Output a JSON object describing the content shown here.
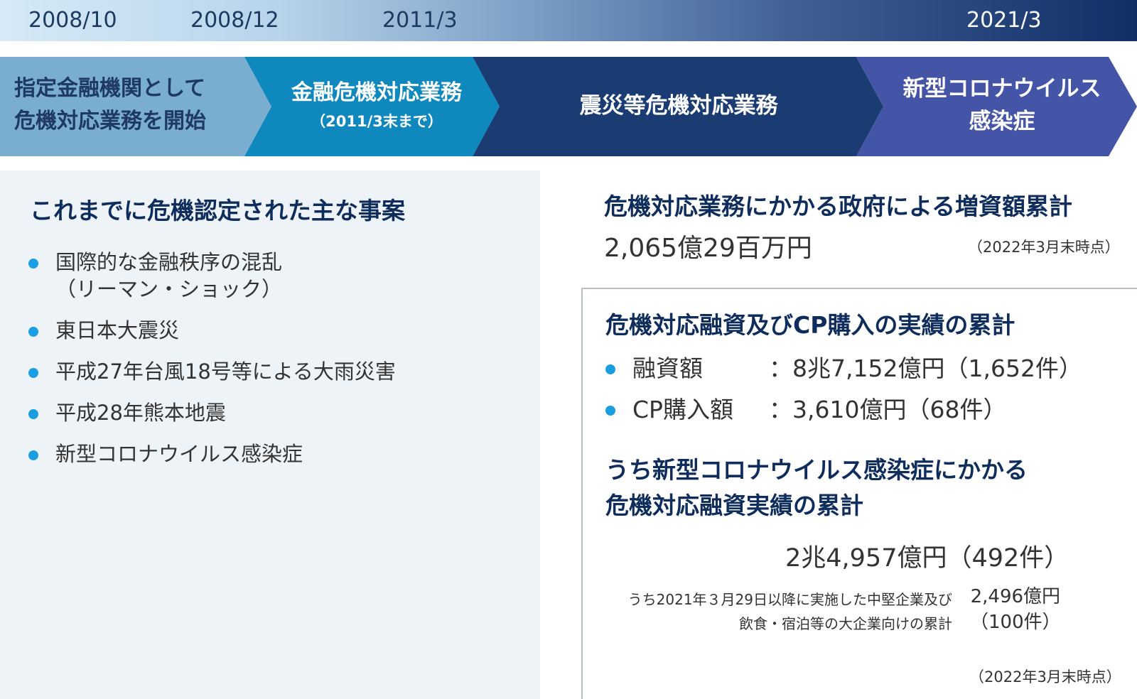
{
  "timeline": {
    "dates": [
      "2008/10",
      "2008/12",
      "2011/3",
      "2021/3"
    ]
  },
  "phases": [
    {
      "line1": "指定金融機関として",
      "line2": "危機対応業務を開始",
      "color": "#7aaed1"
    },
    {
      "line1": "金融危機対応業務",
      "sub": "（2011/3末まで）",
      "color": "#0e88bd"
    },
    {
      "line1": "震災等危機対応業務",
      "color": "#1b3c72"
    },
    {
      "line1": "新型コロナウイルス",
      "line2": "感染症",
      "color": "#4455a8"
    }
  ],
  "left": {
    "title": "これまでに危機認定された主な事案",
    "items": [
      {
        "line1": "国際的な金融秩序の混乱",
        "line2": "（リーマン・ショック）"
      },
      {
        "line1": "東日本大震災"
      },
      {
        "line1": "平成27年台風18号等による大雨災害"
      },
      {
        "line1": "平成28年熊本地震"
      },
      {
        "line1": "新型コロナウイルス感染症"
      }
    ]
  },
  "capital": {
    "title": "危機対応業務にかかる政府による増資額累計",
    "amount": "2,065億29百万円",
    "as_of": "（2022年3月末時点）"
  },
  "results": {
    "title": "危機対応融資及びCP購入の実績の累計",
    "items": [
      {
        "label": "融資額",
        "value": "：8兆7,152億円（1,652件）"
      },
      {
        "label": "CP購入額",
        "value": "：3,610億円（68件）"
      }
    ],
    "covid_title_line1": "うち新型コロナウイルス感染症にかかる",
    "covid_title_line2": "危機対応融資実績の累計",
    "covid_total": "2兆4,957億円（492件）",
    "note_line1": "うち2021年３月29日以降に実施した中堅企業及び",
    "note_line2": "飲食・宿泊等の大企業向けの累計",
    "note_value_line1": "2,496億円",
    "note_value_line2": "（100件）",
    "as_of": "（2022年3月末時点）"
  }
}
